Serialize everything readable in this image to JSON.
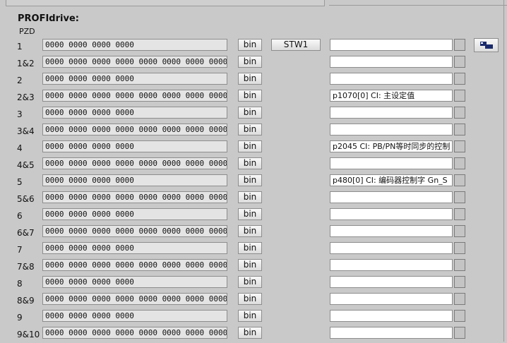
{
  "section_title": "PROFIdrive:",
  "pzd_header": "PZD",
  "bin_label": "bin",
  "rows": [
    {
      "label": "1",
      "bits": "0000 0000 0000 0000",
      "name": "STW1",
      "desc": ""
    },
    {
      "label": "1&2",
      "bits": "0000 0000 0000 0000 0000 0000 0000 0000",
      "name": "",
      "desc": ""
    },
    {
      "label": "2",
      "bits": "0000 0000 0000 0000",
      "name": "",
      "desc": ""
    },
    {
      "label": "2&3",
      "bits": "0000 0000 0000 0000 0000 0000 0000 0000",
      "name": "",
      "desc": "p1070[0] CI: 主设定值"
    },
    {
      "label": "3",
      "bits": "0000 0000 0000 0000",
      "name": "",
      "desc": ""
    },
    {
      "label": "3&4",
      "bits": "0000 0000 0000 0000 0000 0000 0000 0000",
      "name": "",
      "desc": ""
    },
    {
      "label": "4",
      "bits": "0000 0000 0000 0000",
      "name": "",
      "desc": "p2045 CI: PB/PN等时同步的控制"
    },
    {
      "label": "4&5",
      "bits": "0000 0000 0000 0000 0000 0000 0000 0000",
      "name": "",
      "desc": ""
    },
    {
      "label": "5",
      "bits": "0000 0000 0000 0000",
      "name": "",
      "desc": "p480[0] CI: 编码器控制字 Gn_S"
    },
    {
      "label": "5&6",
      "bits": "0000 0000 0000 0000 0000 0000 0000 0000",
      "name": "",
      "desc": ""
    },
    {
      "label": "6",
      "bits": "0000 0000 0000 0000",
      "name": "",
      "desc": ""
    },
    {
      "label": "6&7",
      "bits": "0000 0000 0000 0000 0000 0000 0000 0000",
      "name": "",
      "desc": ""
    },
    {
      "label": "7",
      "bits": "0000 0000 0000 0000",
      "name": "",
      "desc": ""
    },
    {
      "label": "7&8",
      "bits": "0000 0000 0000 0000 0000 0000 0000 0000",
      "name": "",
      "desc": ""
    },
    {
      "label": "8",
      "bits": "0000 0000 0000 0000",
      "name": "",
      "desc": ""
    },
    {
      "label": "8&9",
      "bits": "0000 0000 0000 0000 0000 0000 0000 0000",
      "name": "",
      "desc": ""
    },
    {
      "label": "9",
      "bits": "0000 0000 0000 0000",
      "name": "",
      "desc": ""
    },
    {
      "label": "9&10",
      "bits": "0000 0000 0000 0000 0000 0000 0000 0000",
      "name": "",
      "desc": ""
    }
  ],
  "side_button_icon": "transfer-icon"
}
